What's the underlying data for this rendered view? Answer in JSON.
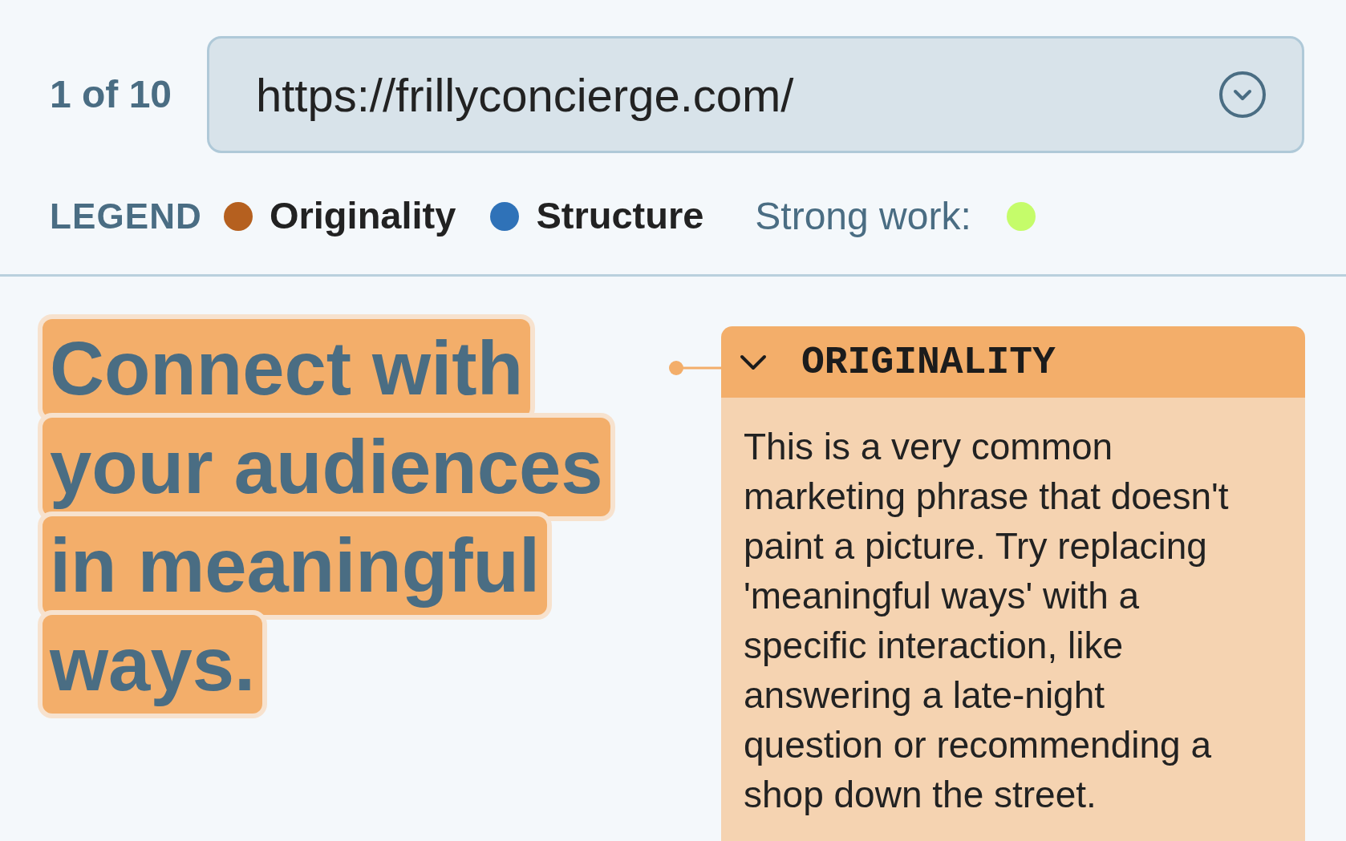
{
  "pager": "1 of 10",
  "url_select": {
    "value": "https://frillyconcierge.com/"
  },
  "legend": {
    "title": "LEGEND",
    "items": [
      {
        "label": "Originality",
        "color": "#b5601f"
      },
      {
        "label": "Structure",
        "color": "#2f72b8"
      }
    ],
    "strong_work": {
      "label": "Strong work:",
      "color": "#c5fc6a"
    }
  },
  "highlighted_text": {
    "lines": [
      "Connect with",
      "your audiences",
      "in meaningful",
      "ways."
    ]
  },
  "comment": {
    "title": "ORIGINALITY",
    "expanded": true,
    "body": "This is a very common marketing phrase that doesn't paint a picture. Try replacing 'meaningful ways' with a specific interaction, like answering a late-night question or recommending a shop down the street."
  }
}
